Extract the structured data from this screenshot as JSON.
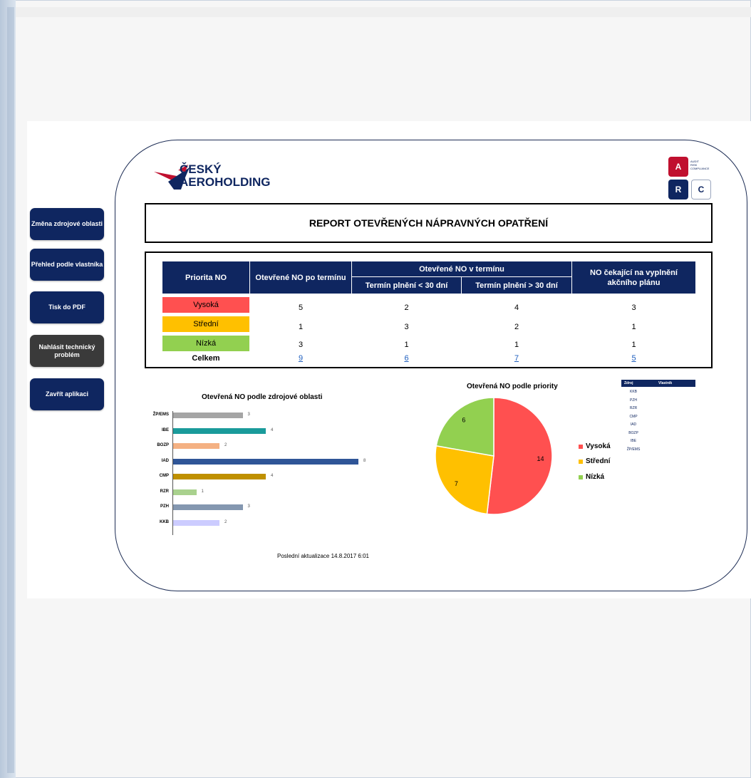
{
  "nav": {
    "zmena": "Změna zdrojové oblasti",
    "prehled": "Přehled podle vlastníka",
    "tisk": "Tisk do PDF",
    "nahlasit": "Nahlásit technický problém",
    "zavrit": "Zavřít aplikaci"
  },
  "logo": {
    "line1": "ČESKÝ",
    "line2": "AEROHOLDING"
  },
  "arc": {
    "a": "A",
    "r": "R",
    "c": "C",
    "sub1": "AUDIT",
    "sub2": "RISK",
    "sub3": "COMPLIANCE"
  },
  "report_title": "REPORT OTEVŘENÝCH NÁPRAVNÝCH OPATŘENÍ",
  "table": {
    "h_priorita": "Priorita NO",
    "h_po_terminu": "Otevřené NO po termínu",
    "h_v_terminu": "Otevřené NO v termínu",
    "h_lt30": "Termín plnění < 30 dní",
    "h_gt30": "Termín plnění > 30 dní",
    "h_cekajici": "NO čekající na vyplnění akčního plánu",
    "rows": [
      {
        "label": "Vysoká",
        "color": "#ff5050",
        "po": "5",
        "lt": "2",
        "gt": "4",
        "cek": "3"
      },
      {
        "label": "Střední",
        "color": "#ffc000",
        "po": "1",
        "lt": "3",
        "gt": "2",
        "cek": "1"
      },
      {
        "label": "Nízká",
        "color": "#92d050",
        "po": "3",
        "lt": "1",
        "gt": "1",
        "cek": "1"
      }
    ],
    "total": {
      "label": "Celkem",
      "po": "9",
      "lt": "6",
      "gt": "7",
      "cek": "5"
    }
  },
  "chart_data": [
    {
      "type": "bar",
      "title": "Otevřená NO podle zdrojové oblasti",
      "categories": [
        "ŽP/EMS",
        "IBE",
        "BOZP",
        "IAD",
        "CMP",
        "RZR",
        "PZH",
        "KKB"
      ],
      "values": [
        3,
        4,
        2,
        8,
        4,
        1,
        3,
        2
      ],
      "colors": [
        "#a5a5a5",
        "#1a9b9b",
        "#f4b183",
        "#2f5597",
        "#bf9000",
        "#a9d18e",
        "#8497b0",
        "#ccccff"
      ],
      "orientation": "horizontal"
    },
    {
      "type": "pie",
      "title": "Otevřená NO podle priority",
      "categories": [
        "Vysoká",
        "Střední",
        "Nízká"
      ],
      "values": [
        14,
        7,
        6
      ],
      "colors": [
        "#ff5050",
        "#ffc000",
        "#92d050"
      ],
      "legend": "right"
    }
  ],
  "mini_table": {
    "h_zdroj": "Zdroj",
    "h_vlastnik": "Vlastník",
    "items": [
      "KKB",
      "PZH",
      "RZR",
      "CMP",
      "IAD",
      "BOZP",
      "IBE",
      "ŽP/EMS"
    ]
  },
  "footer": "Poslední aktualizace  14.8.2017 6:01"
}
